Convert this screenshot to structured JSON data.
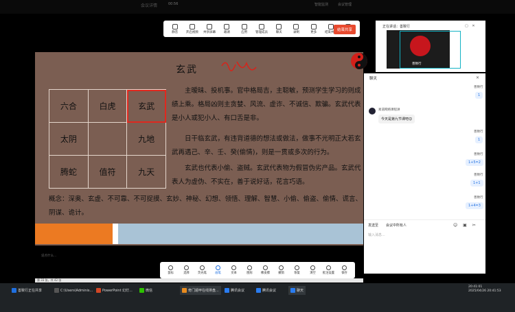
{
  "top_bar": {
    "meeting_title": "会议详情",
    "status": "00:56",
    "right_a": "智能监测",
    "right_b": "会议管理"
  },
  "meeting_toolbar": {
    "items": [
      "静音",
      "开启视频",
      "共享屏幕",
      "邀请",
      "应用",
      "管理成员",
      "聊天",
      "录制",
      "更多",
      "结束共享",
      "暂停共享"
    ],
    "end_button": "结束共享"
  },
  "slide": {
    "title": "玄武",
    "grid": [
      [
        "六合",
        "白虎",
        "玄武"
      ],
      [
        "太阴",
        "",
        "九地"
      ],
      [
        "腾蛇",
        "值符",
        "九天"
      ]
    ],
    "highlighted_cell": "玄武",
    "p1": "主暧昧、投机事。官中格局吉，主聪敏，预测学生学习的则成绩上乘。格局凶则主贪婪、风流、虚诈、不诚信、欺骗。玄武代表是小人或犯小人、有口舌是非。",
    "p2": "日干临玄武，有违背道德的想法或做法，做事不光明正大若玄武再遇己、辛、壬、癸(偷情)，则是一贯或多次的行为。",
    "p3": "玄武也代表小偷、盗贼。玄武代表物为假冒伪劣产品。玄武代表人为虚伪、不实在，善于说好话，花言巧语。",
    "concept": "概念：深奥、玄虚、不可靠、不可捉摸、玄妙、神秘、幻想、领悟、理解、智慧、小偷、偷盗、偷情、谎言、阴谋、诡计。"
  },
  "annotation_toolbar": {
    "items": [
      "鼠标",
      "选择",
      "荧光笔",
      "画笔",
      "文本",
      "图形",
      "橡皮擦",
      "撤销",
      "恢复",
      "清空",
      "批注设置",
      "保存"
    ],
    "active": "画笔"
  },
  "input_hint": "说点什么...",
  "ppt_status": "第 33 张，共 42 张",
  "video": {
    "header": "正在讲话：善致行",
    "name": "善致行"
  },
  "chat": {
    "title": "聊天",
    "messages": [
      {
        "side": "right",
        "sender": "善致行",
        "text": "1"
      },
      {
        "side": "left",
        "sender": "易道网络课程讲",
        "text": "今天是第九节课吧😊"
      },
      {
        "side": "right",
        "sender": "善致行",
        "text": "1"
      },
      {
        "side": "right",
        "sender": "善致行",
        "text": "1+5=2"
      },
      {
        "side": "right",
        "sender": "善致行",
        "text": "1+1"
      },
      {
        "side": "right",
        "sender": "善致行",
        "text": "1+4=3"
      }
    ],
    "send_to_label": "发送至",
    "recipient": "会议中所有人",
    "placeholder": "输入消息..."
  },
  "taskbar": {
    "items": [
      "善致行正在共享",
      "C:\\Users\\Adminis...",
      "PowerPoint 幻灯...",
      "微信",
      "奇门遁甲在线排盘...",
      "腾讯会议",
      "腾讯会议",
      "聊天"
    ],
    "time": "20:41:01",
    "date": "2025/04/26 20:41:53"
  }
}
